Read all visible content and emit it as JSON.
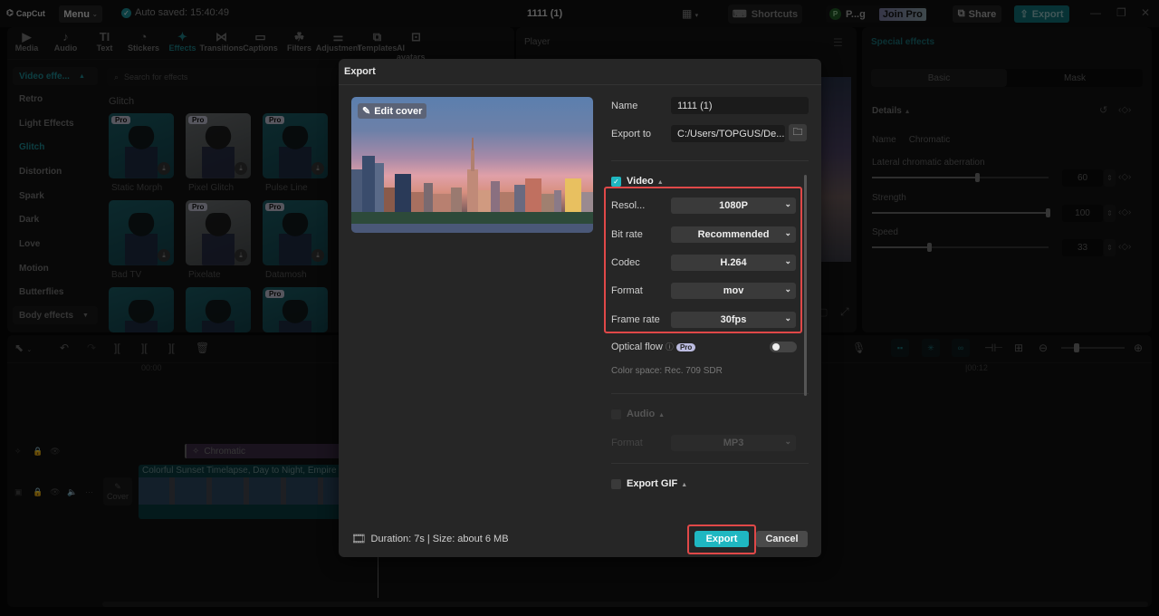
{
  "titlebar": {
    "app_name": "CapCut",
    "menu_label": "Menu",
    "autosave_text": "Auto saved: 15:40:49",
    "project_title": "1111 (1)",
    "shortcuts_label": "Shortcuts",
    "user_initial": "P",
    "user_name": "P...g",
    "join_pro_label": "Join Pro",
    "share_label": "Share",
    "export_label": "Export"
  },
  "toolbar_tabs": [
    {
      "label": "Media",
      "icon": "media-icon",
      "glyph": "▶"
    },
    {
      "label": "Audio",
      "icon": "audio-icon",
      "glyph": "♪"
    },
    {
      "label": "Text",
      "icon": "text-icon",
      "glyph": "TI"
    },
    {
      "label": "Stickers",
      "icon": "stickers-icon",
      "glyph": "◔"
    },
    {
      "label": "Effects",
      "icon": "effects-icon",
      "glyph": "✦",
      "active": true
    },
    {
      "label": "Transitions",
      "icon": "transitions-icon",
      "glyph": "⋈"
    },
    {
      "label": "Captions",
      "icon": "captions-icon",
      "glyph": "▭"
    },
    {
      "label": "Filters",
      "icon": "filters-icon",
      "glyph": "☘"
    },
    {
      "label": "Adjustment",
      "icon": "adjustment-icon",
      "glyph": "⚌"
    },
    {
      "label": "Templates",
      "icon": "templates-icon",
      "glyph": "⧉"
    },
    {
      "label": "AI avatars",
      "icon": "ai-avatars-icon",
      "glyph": "⊡"
    }
  ],
  "effects": {
    "category_dropdown": "Video effe...",
    "categories": [
      "Retro",
      "Light Effects",
      "Glitch",
      "Distortion",
      "Spark",
      "Dark",
      "Love",
      "Motion",
      "Butterflies"
    ],
    "active_category": "Glitch",
    "body_effects_label": "Body effects",
    "search_placeholder": "Search for effects",
    "section_title": "Glitch",
    "items": [
      {
        "name": "Static Morph",
        "pro": true,
        "download": true
      },
      {
        "name": "Pixel Glitch",
        "pro": true,
        "download": true
      },
      {
        "name": "Pulse Line",
        "pro": true,
        "download": true
      },
      {
        "name": "Bad TV",
        "pro": false,
        "download": true
      },
      {
        "name": "Pixelate",
        "pro": true,
        "download": true
      },
      {
        "name": "Datamosh",
        "pro": true,
        "download": true
      },
      {
        "name": "",
        "pro": false,
        "download": false
      },
      {
        "name": "",
        "pro": false,
        "download": false
      },
      {
        "name": "",
        "pro": true,
        "download": false
      }
    ],
    "pro_label": "Pro"
  },
  "player": {
    "title": "Player"
  },
  "special_effects": {
    "title": "Special effects",
    "tabs": [
      "Basic",
      "Mask"
    ],
    "active_tab": "Basic",
    "details_label": "Details",
    "name_label": "Name",
    "name_value": "Chromatic",
    "params": [
      {
        "label": "Lateral chromatic aberration",
        "value": 60,
        "max": 100
      },
      {
        "label": "Strength",
        "value": 100,
        "max": 100
      },
      {
        "label": "Speed",
        "value": 33,
        "max": 100
      }
    ]
  },
  "timeline": {
    "time_start": "00:00",
    "time_mark": "|00:12",
    "effect_clip": "Chromatic",
    "video_clip": "Colorful Sunset Timelapse, Day to Night, Empire S",
    "cover_label": "Cover"
  },
  "export_dialog": {
    "title": "Export",
    "edit_cover_label": "Edit cover",
    "name_label": "Name",
    "name_value": "1111 (1)",
    "export_to_label": "Export to",
    "export_to_value": "C:/Users/TOPGUS/De...",
    "video": {
      "label": "Video",
      "checked": true,
      "fields": [
        {
          "label": "Resol...",
          "value": "1080P"
        },
        {
          "label": "Bit rate",
          "value": "Recommended"
        },
        {
          "label": "Codec",
          "value": "H.264"
        },
        {
          "label": "Format",
          "value": "mov"
        },
        {
          "label": "Frame rate",
          "value": "30fps"
        }
      ],
      "optical_flow_label": "Optical flow",
      "optical_flow_on": false,
      "pro_label": "Pro",
      "color_space": "Color space: Rec. 709 SDR"
    },
    "audio": {
      "label": "Audio",
      "checked": false,
      "format_label": "Format",
      "format_value": "MP3"
    },
    "gif": {
      "label": "Export GIF",
      "checked": false
    },
    "footer_info": "Duration: 7s | Size: about 6 MB",
    "export_button": "Export",
    "cancel_button": "Cancel"
  },
  "colors": {
    "accent": "#1fb7c1",
    "highlight_box": "#e04848",
    "dialog_bg": "#262626"
  }
}
